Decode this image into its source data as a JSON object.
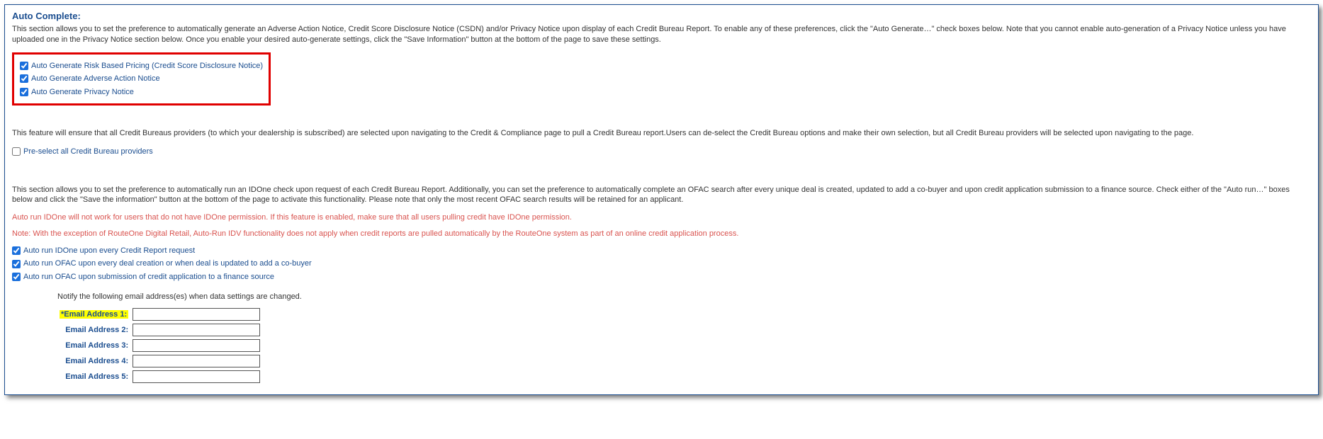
{
  "section_title": "Auto Complete:",
  "description1": "This section allows you to set the preference to automatically generate an Adverse Action Notice, Credit Score Disclosure Notice (CSDN) and/or Privacy Notice upon display of each Credit Bureau Report. To enable any of these preferences, click the \"Auto Generate…\" check boxes below. Note that you cannot enable auto-generation of a Privacy Notice unless you have uploaded one in the Privacy Notice section below. Once you enable your desired auto-generate settings, click the \"Save Information\" button at the bottom of the page to save these settings.",
  "autogen": {
    "risk_label": "Auto Generate Risk Based Pricing (Credit Score Disclosure Notice)",
    "adverse_label": "Auto Generate Adverse Action Notice",
    "privacy_label": "Auto Generate Privacy Notice"
  },
  "description2": "This feature will ensure that all Credit Bureaus providers (to which your dealership is subscribed) are selected upon navigating to the Credit & Compliance page to pull a Credit Bureau report.Users can de-select the Credit Bureau options and make their own selection, but all Credit Bureau providers will be selected upon navigating to the page.",
  "preselect_label": "Pre-select all Credit Bureau providers",
  "description3": "This section allows you to set the preference to automatically run an IDOne check upon request of each Credit Bureau Report. Additionally, you can set the preference to automatically complete an OFAC search after every unique deal is created, updated to add a co-buyer and upon credit application submission to a finance source. Check either of the \"Auto run…\" boxes below and click the \"Save the information\" button at the bottom of the page to activate this functionality. Please note that only the most recent OFAC search results will be retained for an applicant.",
  "warning1": "Auto run IDOne will not work for users that do not have IDOne permission. If this feature is enabled, make sure that all users pulling credit have IDOne permission.",
  "warning2": "Note: With the exception of RouteOne Digital Retail, Auto-Run IDV functionality does not apply when credit reports are pulled automatically by the RouteOne system as part of an online credit application process.",
  "autorun": {
    "idone_label": "Auto run IDOne upon every Credit Report request",
    "ofac_deal_label": "Auto run OFAC upon every deal creation or when deal is updated to add a co-buyer",
    "ofac_submit_label": "Auto run OFAC upon submission of credit application to a finance source"
  },
  "email_notify_text": "Notify the following email address(es) when data settings are changed.",
  "emails": {
    "label1": "*Email Address 1:",
    "label2": "Email Address 2:",
    "label3": "Email Address 3:",
    "label4": "Email Address 4:",
    "label5": "Email Address 5:",
    "value1": "",
    "value2": "",
    "value3": "",
    "value4": "",
    "value5": ""
  }
}
